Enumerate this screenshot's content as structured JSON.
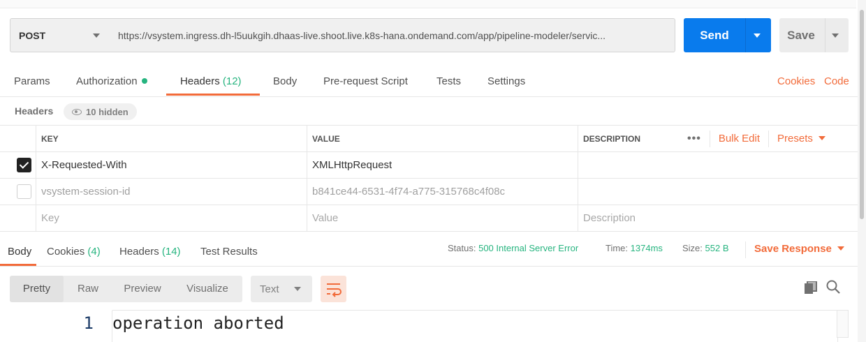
{
  "request": {
    "method": "POST",
    "url": "https://vsystem.ingress.dh-l5uukgih.dhaas-live.shoot.live.k8s-hana.ondemand.com/app/pipeline-modeler/servic...",
    "send_label": "Send",
    "save_label": "Save"
  },
  "request_tabs": {
    "params": "Params",
    "authorization": "Authorization",
    "headers": "Headers",
    "headers_count": "(12)",
    "body": "Body",
    "prerequest": "Pre-request Script",
    "tests": "Tests",
    "settings": "Settings",
    "cookies": "Cookies",
    "code": "Code"
  },
  "headers_section": {
    "title": "Headers",
    "hidden": "10 hidden"
  },
  "table": {
    "columns": {
      "key": "KEY",
      "value": "VALUE",
      "description": "DESCRIPTION"
    },
    "bulk_edit": "Bulk Edit",
    "presets": "Presets",
    "more": "•••",
    "rows": [
      {
        "checked": true,
        "key": "X-Requested-With",
        "value": "XMLHttpRequest",
        "description": ""
      },
      {
        "checked": false,
        "key": "vsystem-session-id",
        "value": "b841ce44-6531-4f74-a775-315768c4f08c",
        "description": ""
      }
    ],
    "placeholders": {
      "key": "Key",
      "value": "Value",
      "description": "Description"
    }
  },
  "response": {
    "tabs": {
      "body": "Body",
      "cookies": "Cookies",
      "cookies_count": "(4)",
      "headers": "Headers",
      "headers_count": "(14)",
      "test_results": "Test Results"
    },
    "status_label": "Status:",
    "status_value": "500 Internal Server Error",
    "time_label": "Time:",
    "time_value": "1374ms",
    "size_label": "Size:",
    "size_value": "552 B",
    "save_response": "Save Response",
    "views": [
      "Pretty",
      "Raw",
      "Preview",
      "Visualize"
    ],
    "format": "Text",
    "line_number": "1",
    "body_text": "operation aborted"
  },
  "colors": {
    "accent": "#f26b3a",
    "send": "#097bed",
    "success": "#26b47f"
  }
}
